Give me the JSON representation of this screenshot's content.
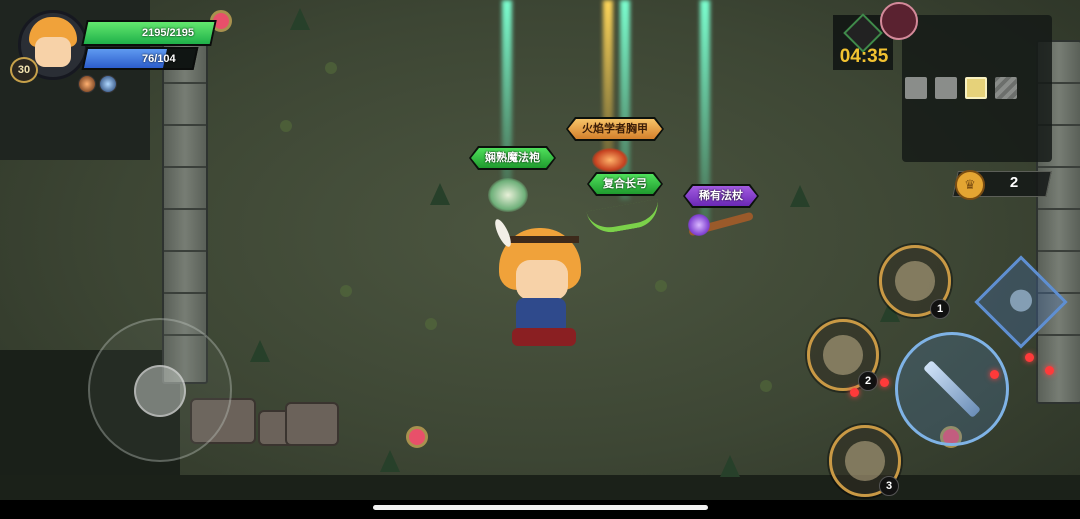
{
  "player": {
    "level": "30",
    "hp_text": "2195/2195",
    "hp_fraction": 1.0,
    "mp_text": "76/104",
    "mp_fraction": 0.73,
    "buffs": [
      "burst-buff-icon",
      "swirl-buff-icon"
    ]
  },
  "timer": {
    "icon": "stopwatch-icon",
    "text": "04:35"
  },
  "boss": {
    "icon": "demon-boss-icon"
  },
  "minimap": {
    "slots": [
      "empty-room",
      "empty-room",
      "chess-piece-room",
      "locked-room"
    ]
  },
  "crowns": {
    "icon": "crown-icon",
    "count": "2"
  },
  "loot": {
    "robe_label": "娴熟魔法袍",
    "armor_label": "火焰学者胸甲",
    "bow_label": "复合长弓",
    "staff_label": "稀有法杖"
  },
  "skills": {
    "skill1_num": "1",
    "skill2_num": "2",
    "skill3_num": "3",
    "skill1_icon": "arrow-volley-skill-icon",
    "skill2_icon": "fireball-skill-icon",
    "skill3_icon": "summon-skill-icon",
    "attack_icon": "sword-attack-icon",
    "dash_icon": "dash-icon"
  },
  "colors": {
    "hp": "#2fbf52",
    "mp": "#3e73dd",
    "timer": "#f2c231",
    "label_green": "#2fb83e",
    "label_orange": "#e99a3a",
    "label_purple": "#7e36c4",
    "skill_ring": "#c99945"
  }
}
